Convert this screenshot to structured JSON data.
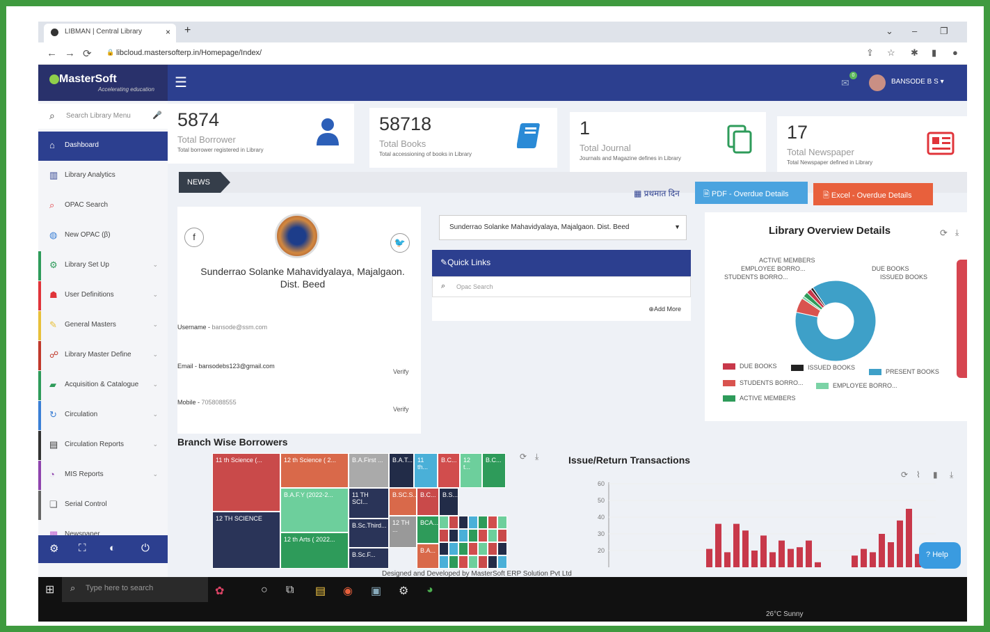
{
  "browser": {
    "tab_title": "LIBMAN | Central Library",
    "url": "libcloud.mastersofterp.in/Homepage/Index/"
  },
  "app": {
    "brand": "MasterSoft",
    "tagline": "Accelerating education",
    "user": "BANSODE B S",
    "mail_badge": "0"
  },
  "sidebar": {
    "search_placeholder": "Search Library Menu",
    "items": [
      {
        "label": "Dashboard",
        "icon": "home-icon",
        "color": "#fff"
      },
      {
        "label": "Library Analytics",
        "icon": "chart-icon",
        "color": "#2c3f8f"
      },
      {
        "label": "OPAC Search",
        "icon": "search-icon",
        "color": "#e0343a"
      },
      {
        "label": "New OPAC (β)",
        "icon": "globe-icon",
        "color": "#3a7fd5"
      },
      {
        "label": "Library Set Up",
        "icon": "gears-icon",
        "color": "#2e9b5a"
      },
      {
        "label": "User Definitions",
        "icon": "users-icon",
        "color": "#e0343a"
      },
      {
        "label": "General Masters",
        "icon": "edit-icon",
        "color": "#e8c03a"
      },
      {
        "label": "Library Master Define",
        "icon": "sitemap-icon",
        "color": "#c0392b"
      },
      {
        "label": "Acquisition & Catalogue",
        "icon": "book-icon",
        "color": "#2e9b5a"
      },
      {
        "label": "Circulation",
        "icon": "refresh-icon",
        "color": "#3a7fd5"
      },
      {
        "label": "Circulation Reports",
        "icon": "report-icon",
        "color": "#333"
      },
      {
        "label": "MIS Reports",
        "icon": "pie-icon",
        "color": "#8e44ad"
      },
      {
        "label": "Serial Control",
        "icon": "copy-icon",
        "color": "#666"
      },
      {
        "label": "Newspaper",
        "icon": "newspaper-icon",
        "color": "#c05fd0"
      }
    ]
  },
  "stats": [
    {
      "value": "5874",
      "label": "Total Borrower",
      "sub": "Total borrower registered in Library",
      "icon": "user-icon",
      "color": "#2c5fb8"
    },
    {
      "value": "58718",
      "label": "Total Books",
      "sub": "Total accessioning of books in Library",
      "icon": "book-icon",
      "color": "#2a8ad6"
    },
    {
      "value": "1",
      "label": "Total Journal",
      "sub": "Journals and Magazine defines in Library",
      "icon": "copy-icon",
      "color": "#2e9b5a"
    },
    {
      "value": "17",
      "label": "Total Newspaper",
      "sub": "Total Newspaper defined in Library",
      "icon": "newspaper-icon",
      "color": "#e0343a"
    }
  ],
  "news": {
    "label": "NEWS",
    "hindi": "प्रथमात दिन",
    "pdf_button": "PDF - Overdue Details",
    "excel_button": "Excel - Overdue Details"
  },
  "profile": {
    "college": "Sunderrao Solanke Mahavidyalaya, Majalgaon. Dist. Beed",
    "username_label": "Username - ",
    "username": "bansode@ssm.com",
    "email_label": "Email - ",
    "email": "bansodebs123@gmail.com",
    "mobile_label": "Mobile - ",
    "mobile": "7058088555",
    "verify": "Verify"
  },
  "quick_links": {
    "selected_library": "Sunderrao Solanke Mahavidyalaya, Majalgaon. Dist. Beed",
    "title": "Quick Links",
    "search_placeholder": "Opac Search",
    "add_more": "Add More"
  },
  "overview": {
    "title": "Library Overview Details",
    "labels": [
      "ACTIVE MEMBERS",
      "EMPLOYEE BORRO...",
      "STUDENTS BORRO...",
      "DUE BOOKS",
      "ISSUED BOOKS"
    ],
    "legend": [
      {
        "name": "DUE BOOKS",
        "color": "#c8384a"
      },
      {
        "name": "ISSUED BOOKS",
        "color": "#222222"
      },
      {
        "name": "PRESENT BOOKS",
        "color": "#3ea0c8"
      },
      {
        "name": "STUDENTS BORRO...",
        "color": "#d9534f"
      },
      {
        "name": "EMPLOYEE BORRO...",
        "color": "#7bd3a6"
      },
      {
        "name": "ACTIVE MEMBERS",
        "color": "#2e9b5a"
      }
    ],
    "slices": [
      {
        "name": "PRESENT BOOKS",
        "value": 88,
        "color": "#3ea0c8"
      },
      {
        "name": "STUDENTS BORRO...",
        "value": 6,
        "color": "#d9534f"
      },
      {
        "name": "EMPLOYEE BORRO...",
        "value": 1,
        "color": "#7bd3a6"
      },
      {
        "name": "ACTIVE MEMBERS",
        "value": 2,
        "color": "#2e9b5a"
      },
      {
        "name": "DUE BOOKS",
        "value": 2,
        "color": "#c8384a"
      },
      {
        "name": "ISSUED BOOKS",
        "value": 1,
        "color": "#222222"
      }
    ]
  },
  "branch": {
    "title": "Branch Wise Borrowers",
    "tiles": [
      {
        "label": "11 th Science (...",
        "color": "#c94a4a"
      },
      {
        "label": "12 th Science ( 2...",
        "color": "#d9694a"
      },
      {
        "label": "B.A.First ...",
        "color": "#aaaaaa"
      },
      {
        "label": "B.A.T...",
        "color": "#222c48"
      },
      {
        "label": "11 th...",
        "color": "#4ab0d8"
      },
      {
        "label": "B.C...",
        "color": "#d14d4d"
      },
      {
        "label": "12 t...",
        "color": "#6dcf9c"
      },
      {
        "label": "B.C...",
        "color": "#2e9b5a"
      },
      {
        "label": "12 TH SCIENCE",
        "color": "#2a3458"
      },
      {
        "label": "B.A.F.Y (2022-2...",
        "color": "#6dcf9c"
      },
      {
        "label": "11 TH SCI...",
        "color": "#2a3458"
      },
      {
        "label": "B.SC.S...",
        "color": "#d9694a"
      },
      {
        "label": "B.C...",
        "color": "#c94a4a"
      },
      {
        "label": "B.S...",
        "color": "#222c48"
      },
      {
        "label": "12 th Arts ( 2022...",
        "color": "#2e9b5a"
      },
      {
        "label": "B.Sc.Third...",
        "color": "#2a3458"
      },
      {
        "label": "12 TH ...",
        "color": "#999999"
      },
      {
        "label": "BCA...",
        "color": "#2e9b5a"
      },
      {
        "label": "B.Sc.F...",
        "color": "#2a3458"
      },
      {
        "label": "B.A...",
        "color": "#d9694a"
      }
    ]
  },
  "transactions": {
    "title": "Issue/Return Transactions"
  },
  "chart_data": {
    "type": "bar",
    "title": "Issue/Return Transactions",
    "ylim": [
      0,
      60
    ],
    "yticks": [
      20,
      30,
      40,
      50,
      60
    ],
    "values": [
      11,
      26,
      9,
      26,
      22,
      10,
      19,
      9,
      16,
      11,
      12,
      16,
      3,
      7,
      11,
      9,
      20,
      15,
      28,
      35,
      8
    ],
    "color": "#c8384a"
  },
  "footer": "Designed and Developed by MasterSoft ERP Solution Pvt Ltd",
  "help": "Help",
  "taskbar": {
    "search_placeholder": "Type here to search",
    "weather": "26°C Sunny"
  }
}
